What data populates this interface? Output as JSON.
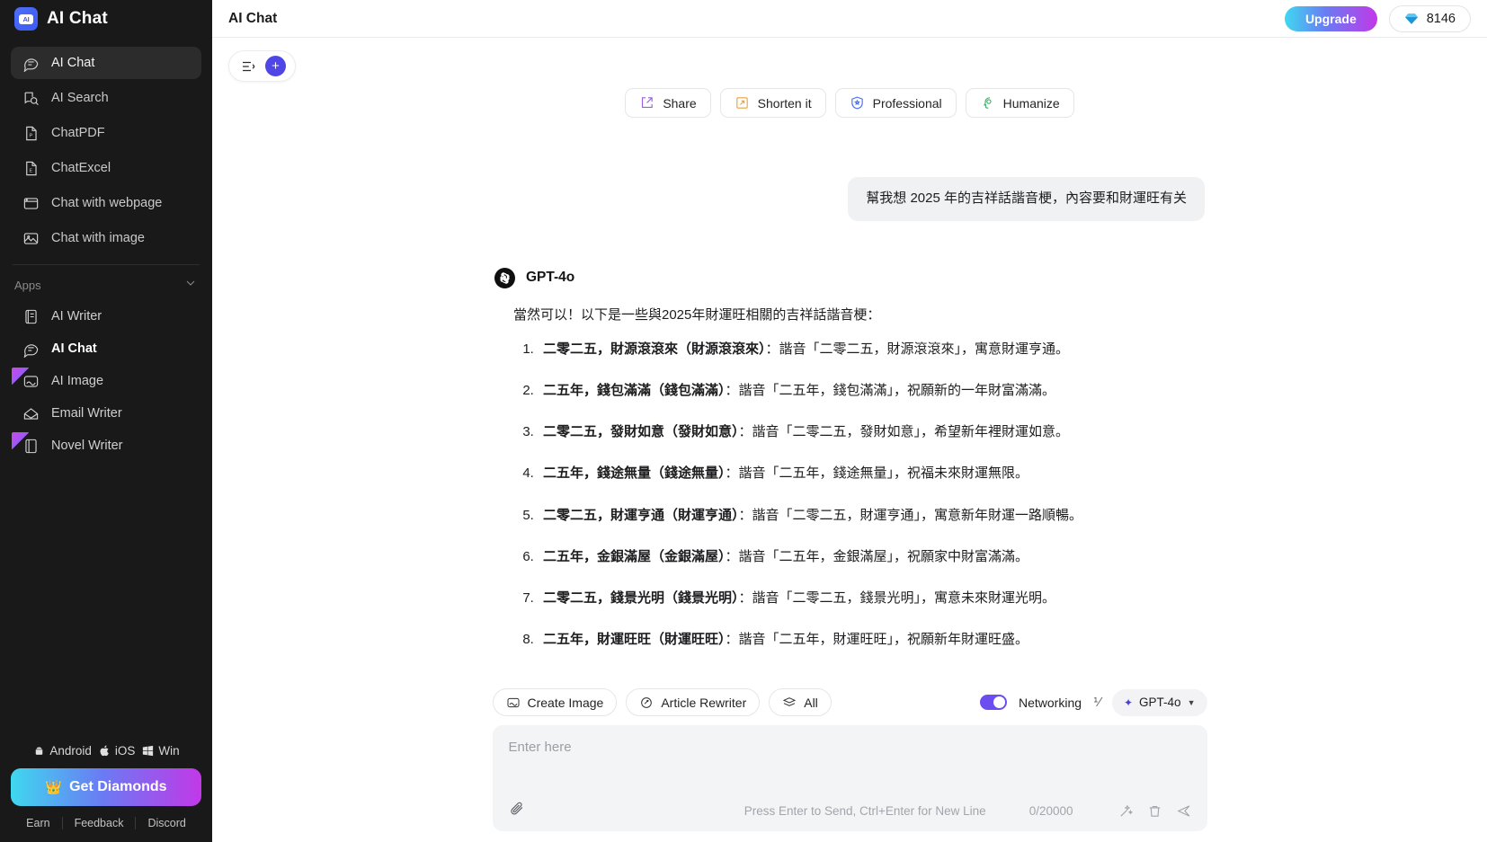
{
  "brand": {
    "logo_text": "AI",
    "title": "AI Chat"
  },
  "sidebar": {
    "nav": [
      {
        "label": "AI Chat",
        "icon": "chat-icon",
        "active": true
      },
      {
        "label": "AI Search",
        "icon": "search-doc-icon",
        "active": false
      },
      {
        "label": "ChatPDF",
        "icon": "pdf-icon",
        "active": false
      },
      {
        "label": "ChatExcel",
        "icon": "excel-icon",
        "active": false
      },
      {
        "label": "Chat with webpage",
        "icon": "browser-icon",
        "active": false
      },
      {
        "label": "Chat with image",
        "icon": "image-icon",
        "active": false
      }
    ],
    "apps_header": "Apps",
    "apps": [
      {
        "label": "AI Writer",
        "icon": "writer-icon",
        "selected": false,
        "ribbon": false
      },
      {
        "label": "AI Chat",
        "icon": "chat-icon",
        "selected": true,
        "ribbon": false
      },
      {
        "label": "AI Image",
        "icon": "image-icon",
        "selected": false,
        "ribbon": true
      },
      {
        "label": "Email Writer",
        "icon": "envelope-icon",
        "selected": false,
        "ribbon": false
      },
      {
        "label": "Novel Writer",
        "icon": "book-icon",
        "selected": false,
        "ribbon": true
      }
    ],
    "platforms": [
      {
        "label": "Android",
        "icon": "android-icon"
      },
      {
        "label": "iOS",
        "icon": "apple-icon"
      },
      {
        "label": "Win",
        "icon": "windows-icon"
      }
    ],
    "get_diamonds": "Get Diamonds",
    "links": [
      "Earn",
      "Feedback",
      "Discord"
    ]
  },
  "topbar": {
    "title": "AI Chat",
    "upgrade": "Upgrade",
    "diamonds": "8146"
  },
  "actions": [
    {
      "label": "Share",
      "icon": "share-icon",
      "color": "#9b5de5"
    },
    {
      "label": "Shorten it",
      "icon": "shorten-icon",
      "color": "#e8a33d"
    },
    {
      "label": "Professional",
      "icon": "shield-icon",
      "color": "#4a6cf7"
    },
    {
      "label": "Humanize",
      "icon": "humanize-icon",
      "color": "#3fae6a"
    }
  ],
  "chat": {
    "user_message": "幫我想 2025 年的吉祥話諧音梗，內容要和財運旺有关",
    "assistant_name": "GPT-4o",
    "assistant_intro": "當然可以！以下是一些與2025年財運旺相關的吉祥話諧音梗：",
    "points": [
      {
        "bold": "二零二五，財源滾滾來（財源滾滾來）",
        "rest": "：諧音「二零二五，財源滾滾來」，寓意財運亨通。"
      },
      {
        "bold": "二五年，錢包滿滿（錢包滿滿）",
        "rest": "：諧音「二五年，錢包滿滿」，祝願新的一年財富滿滿。"
      },
      {
        "bold": "二零二五，發財如意（發財如意）",
        "rest": "：諧音「二零二五，發財如意」，希望新年裡財運如意。"
      },
      {
        "bold": "二五年，錢途無量（錢途無量）",
        "rest": "：諧音「二五年，錢途無量」，祝福未來財運無限。"
      },
      {
        "bold": "二零二五，財運亨通（財運亨通）",
        "rest": "：諧音「二零二五，財運亨通」，寓意新年財運一路順暢。"
      },
      {
        "bold": "二五年，金銀滿屋（金銀滿屋）",
        "rest": "：諧音「二五年，金銀滿屋」，祝願家中財富滿滿。"
      },
      {
        "bold": "二零二五，錢景光明（錢景光明）",
        "rest": "：諧音「二零二五，錢景光明」，寓意未來財運光明。"
      },
      {
        "bold": "二五年，財運旺旺（財運旺旺）",
        "rest": "：諧音「二五年，財運旺旺」，祝願新年財運旺盛。"
      }
    ]
  },
  "composer": {
    "tools": [
      {
        "label": "Create Image",
        "icon": "image-icon"
      },
      {
        "label": "Article Rewriter",
        "icon": "rewrite-icon"
      },
      {
        "label": "All",
        "icon": "layers-icon"
      }
    ],
    "networking_label": "Networking",
    "networking_on": true,
    "percent_label": "⅟",
    "model": "GPT-4o",
    "placeholder": "Enter here",
    "hint": "Press Enter to Send, Ctrl+Enter for New Line",
    "counter": "0/20000"
  }
}
